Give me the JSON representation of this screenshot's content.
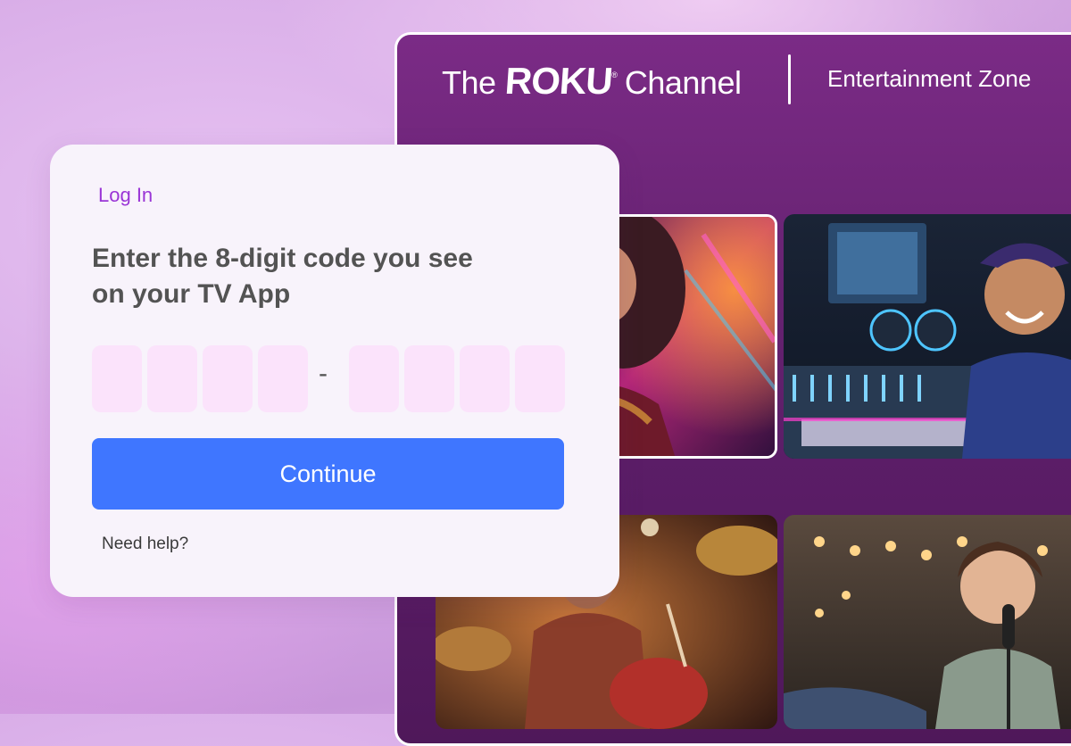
{
  "tv": {
    "logo": {
      "the": "The",
      "roku": "ROKU",
      "trademark": "®",
      "channel": "Channel"
    },
    "zone_label": "Entertainment Zone",
    "tiles": [
      {
        "name": "tile-dancer",
        "subject": "woman with flowing hair under neon lights"
      },
      {
        "name": "tile-music-producer",
        "subject": "smiling man at a mixing console"
      },
      {
        "name": "tile-drummer",
        "subject": "drummer on stage"
      },
      {
        "name": "tile-singer",
        "subject": "woman singing into microphone"
      }
    ]
  },
  "login": {
    "title": "Log In",
    "instruction": "Enter the 8-digit code you see on your TV App",
    "code_separator": "-",
    "code_digits": [
      "",
      "",
      "",
      "",
      "",
      "",
      "",
      ""
    ],
    "continue_label": "Continue",
    "help_label": "Need help?"
  },
  "colors": {
    "accent_purple": "#9a35d6",
    "button_blue": "#3f76ff",
    "code_box_bg": "#fbe3fb",
    "panel_purple": "#6a2475"
  }
}
